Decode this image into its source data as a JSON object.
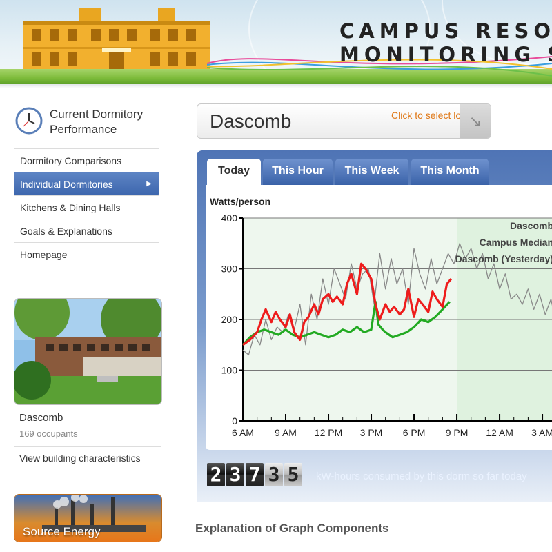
{
  "header": {
    "title_line1": "CAMPUS RESOURCE",
    "title_line2": "MONITORING SYSTEM"
  },
  "sidebar": {
    "heading": "Current Dormitory Performance",
    "items": [
      {
        "label": "Dormitory Comparisons",
        "active": false
      },
      {
        "label": "Individual Dormitories",
        "active": true
      },
      {
        "label": "Kitchens & Dining Halls",
        "active": false
      },
      {
        "label": "Goals & Explanations",
        "active": false
      },
      {
        "label": "Homepage",
        "active": false
      }
    ],
    "building_name": "Dascomb",
    "occupants": "169 occupants",
    "view_link": "View building characteristics",
    "source_button": "Source Energy"
  },
  "location": {
    "name": "Dascomb",
    "hint": "Click to select location"
  },
  "tabs": [
    "Today",
    "This Hour",
    "This Week",
    "This Month"
  ],
  "counter": {
    "digits": [
      "2",
      "3",
      "7",
      "3",
      "5"
    ],
    "label": "kW-hours consumed by this dorm so far today"
  },
  "explanation_heading": "Explanation of Graph Components",
  "colors": {
    "accent": "#3d66ad",
    "today": "#ee1c1c",
    "median": "#22aa22",
    "yesterday": "#888888"
  },
  "chart_data": {
    "type": "line",
    "ylabel": "Watts/person",
    "ylim": [
      0,
      400
    ],
    "yticks": [
      0,
      100,
      200,
      300,
      400
    ],
    "xlabels": [
      "6 AM",
      "9 AM",
      "12 PM",
      "3 PM",
      "6 PM",
      "9 PM",
      "12 AM",
      "3 AM"
    ],
    "x_unit": "hours since 6 AM",
    "legend": [
      "Dascomb",
      "Campus Median",
      "Dascomb (Yesterday)"
    ],
    "series": [
      {
        "name": "Dascomb",
        "color": "#ee1c1c",
        "x": [
          0,
          0.5,
          1,
          1.3,
          1.6,
          2,
          2.3,
          2.6,
          3,
          3.3,
          3.6,
          4,
          4.3,
          4.6,
          5,
          5.3,
          5.6,
          6,
          6.3,
          6.6,
          7,
          7.3,
          7.6,
          8,
          8.3,
          8.6,
          9,
          9.3,
          9.6,
          10,
          10.3,
          10.6,
          11,
          11.3,
          11.6,
          12,
          12.3,
          12.6,
          13,
          13.3,
          13.6,
          14,
          14.3,
          14.6
        ],
        "y": [
          150,
          160,
          175,
          200,
          220,
          195,
          215,
          200,
          185,
          210,
          175,
          160,
          195,
          205,
          230,
          210,
          240,
          250,
          235,
          245,
          230,
          270,
          290,
          250,
          310,
          300,
          280,
          230,
          200,
          230,
          215,
          225,
          210,
          220,
          260,
          205,
          240,
          230,
          215,
          255,
          240,
          225,
          270,
          280
        ]
      },
      {
        "name": "Campus Median",
        "color": "#22aa22",
        "x": [
          0,
          0.5,
          1,
          1.5,
          2,
          2.5,
          3,
          3.5,
          4,
          4.5,
          5,
          5.5,
          6,
          6.5,
          7,
          7.5,
          8,
          8.5,
          9,
          9.3,
          9.5,
          9.8,
          10,
          10.5,
          11,
          11.5,
          12,
          12.5,
          13,
          13.5,
          14,
          14.5
        ],
        "y": [
          150,
          165,
          175,
          180,
          175,
          170,
          180,
          170,
          165,
          170,
          175,
          170,
          165,
          170,
          180,
          175,
          185,
          175,
          180,
          235,
          190,
          180,
          175,
          165,
          170,
          175,
          185,
          200,
          195,
          205,
          220,
          235
        ]
      },
      {
        "name": "Dascomb (Yesterday)",
        "color": "#888888",
        "x": [
          0,
          0.4,
          0.8,
          1.2,
          1.6,
          2,
          2.4,
          2.8,
          3.2,
          3.6,
          4,
          4.4,
          4.8,
          5.2,
          5.6,
          6,
          6.4,
          6.8,
          7.2,
          7.6,
          8,
          8.4,
          8.8,
          9.2,
          9.6,
          10,
          10.4,
          10.8,
          11.2,
          11.6,
          12,
          12.4,
          12.8,
          13.2,
          13.6,
          14,
          14.4,
          14.8,
          15.2,
          15.6,
          16,
          16.4,
          16.8,
          17.2,
          17.6,
          18,
          18.4,
          18.8,
          19.2,
          19.6,
          20,
          20.4,
          20.8,
          21.2,
          21.6,
          22,
          22.4,
          22.8,
          23.2
        ],
        "y": [
          140,
          130,
          170,
          150,
          200,
          160,
          185,
          175,
          210,
          180,
          230,
          150,
          250,
          200,
          280,
          230,
          300,
          270,
          240,
          310,
          260,
          290,
          300,
          230,
          330,
          260,
          320,
          270,
          300,
          230,
          340,
          290,
          260,
          320,
          270,
          300,
          330,
          310,
          350,
          320,
          340,
          300,
          330,
          280,
          310,
          260,
          290,
          240,
          250,
          230,
          260,
          220,
          250,
          210,
          240,
          190,
          210,
          180,
          200
        ]
      }
    ]
  }
}
